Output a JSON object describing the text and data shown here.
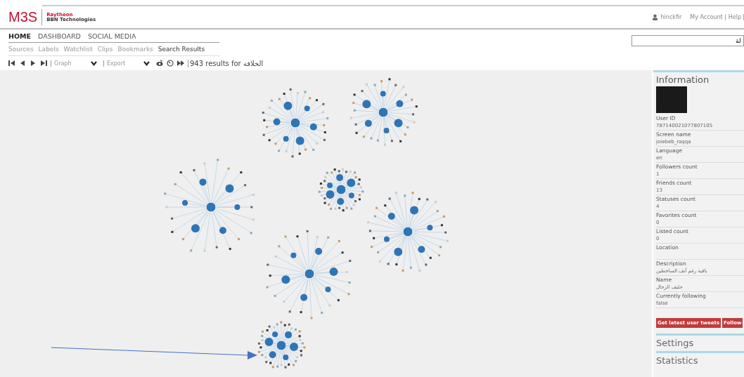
{
  "brand": {
    "logo": "M3S",
    "company": "Raytheon",
    "division": "BBN Technologies"
  },
  "user_menu": {
    "username": "hinckfir",
    "links": [
      "My Account",
      "Help"
    ]
  },
  "main_nav": [
    {
      "label": "HOME",
      "selected": true
    },
    {
      "label": "DASHBOARD",
      "selected": false
    },
    {
      "label": "SOCIAL MEDIA",
      "selected": false
    }
  ],
  "sub_nav": [
    {
      "label": "Sources",
      "selected": false
    },
    {
      "label": "Labels",
      "selected": false
    },
    {
      "label": "Watchlist",
      "selected": false
    },
    {
      "label": "Clips",
      "selected": false
    },
    {
      "label": "Bookmarks",
      "selected": false
    },
    {
      "label": "Search Results",
      "selected": true
    }
  ],
  "search": {
    "value": "لة"
  },
  "toolbar": {
    "view": "Graph",
    "export": "Export",
    "results": "943 results for الخلافة"
  },
  "info_panel": {
    "title": "Information",
    "fields": [
      {
        "label": "User ID",
        "value": "787140021077807105"
      },
      {
        "label": "Screen name",
        "value": "joiebeb_raqqa"
      },
      {
        "label": "Language",
        "value": "en"
      },
      {
        "label": "Followers count",
        "value": "1"
      },
      {
        "label": "Friends count",
        "value": "13"
      },
      {
        "label": "Statuses count",
        "value": "4"
      },
      {
        "label": "Favorites count",
        "value": "0"
      },
      {
        "label": "Listed count",
        "value": "0"
      },
      {
        "label": "Location"
      },
      {
        "label": "Description",
        "value": "باقية رغم أنف الساخطين"
      },
      {
        "label": "Name",
        "value": "حليف الرجال"
      },
      {
        "label": "Currently following",
        "value": "false"
      }
    ],
    "buttons": [
      "Get latest user tweets",
      "Follow"
    ]
  },
  "sections": [
    "Settings",
    "Statistics"
  ]
}
